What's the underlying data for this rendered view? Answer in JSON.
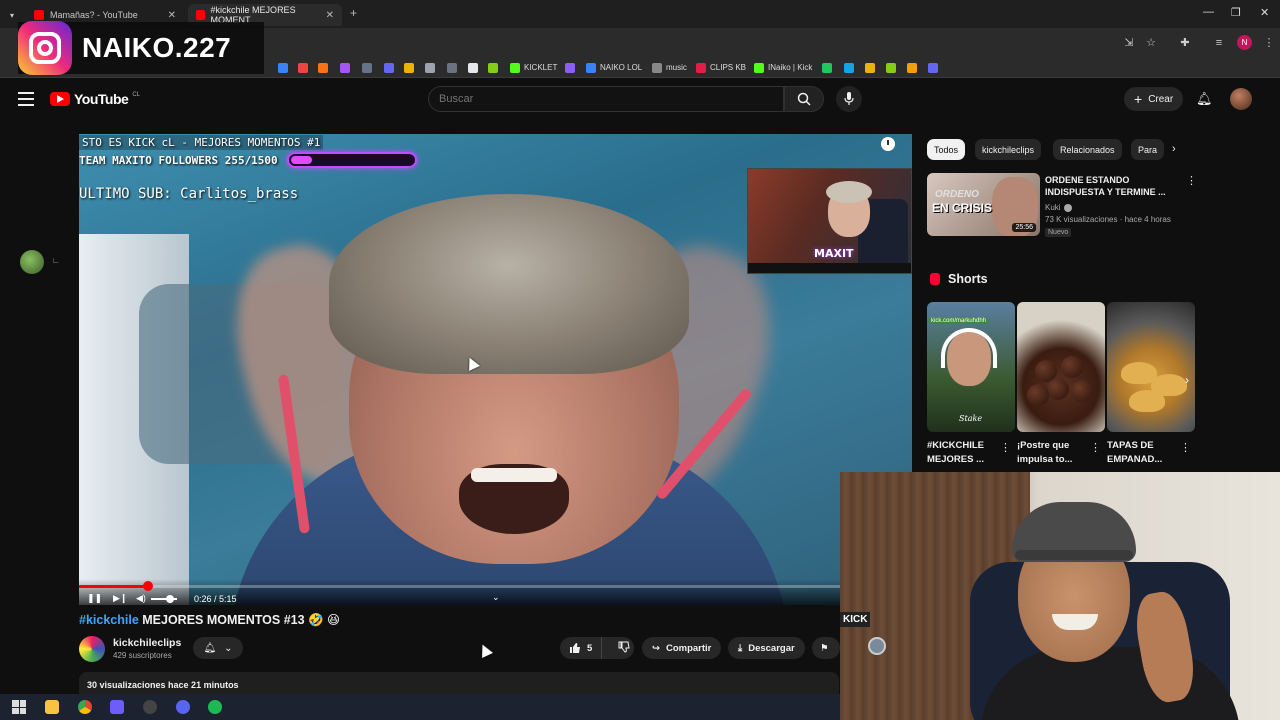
{
  "browser": {
    "tabs": [
      {
        "title": "Mamañas? - YouTube",
        "active": false
      },
      {
        "title": "#kickchile MEJORES MOMENT",
        "active": true
      }
    ],
    "bookmarks": [
      {
        "label": "KICKLET",
        "color": "#53fc18"
      },
      {
        "label": "NAIKO LOL",
        "color": "#3b82f6"
      },
      {
        "label": "music",
        "color": "#888888"
      },
      {
        "label": "CLIPS KB",
        "color": "#e11d48"
      },
      {
        "label": "INaiko | Kick",
        "color": "#53fc18"
      }
    ],
    "profile_initial": "N"
  },
  "overlay": {
    "instagram_handle": "NAIKO.227"
  },
  "youtube": {
    "logo_text": "YouTube",
    "country_code": "CL",
    "search_placeholder": "Buscar",
    "create_label": "Crear",
    "accent_red": "#ff0000",
    "link_blue": "#3ea6ff"
  },
  "player": {
    "stream_title": "STO ES KICK cL - MEJORES MOMENTOS #1",
    "followers_text": "TEAM MAXITO FOLLOWERS 255/1500",
    "followers_current": 255,
    "followers_goal": 1500,
    "last_sub": "ULTIMO SUB: Carlitos_brass",
    "pip_tag": "MAXIT",
    "time_current": "0:26",
    "time_total": "5:15",
    "time_display": "0:26 / 5:15",
    "progress_fraction": 0.0825
  },
  "video": {
    "hashtag": "#kickchile",
    "title_rest": " MEJORES MOMENTOS #13 🤣 😆",
    "channel_name": "kickchileclips",
    "subscribers": "429 suscriptores",
    "likes": "5",
    "share_label": "Compartir",
    "download_label": "Descargar",
    "stats": "30 visualizaciones  hace 21 minutos"
  },
  "sidebar": {
    "chips": [
      {
        "label": "Todos",
        "active": true
      },
      {
        "label": "kickchileclips",
        "active": false
      },
      {
        "label": "Relacionados",
        "active": false
      },
      {
        "label": "Para",
        "active": false
      }
    ],
    "recommended": {
      "title": "ORDENE ESTANDO INDISPUESTA Y TERMINE ...",
      "channel": "Kuki",
      "meta": "73 K visualizaciones · hace 4 horas",
      "badge": "Nuevo",
      "duration": "25:56",
      "thumb_line1": "ORDENO",
      "thumb_line2": "EN CRISIS"
    },
    "shorts_label": "Shorts",
    "shorts": [
      {
        "title": "#KICKCHILE MEJORES ...",
        "overlay_url": "kick.com/markuhdhh",
        "signature": "Stake"
      },
      {
        "title": "¡Postre que impulsa to..."
      },
      {
        "title": "TAPAS DE EMPANAD..."
      }
    ]
  },
  "facecam": {
    "sign_text": "KICK"
  }
}
